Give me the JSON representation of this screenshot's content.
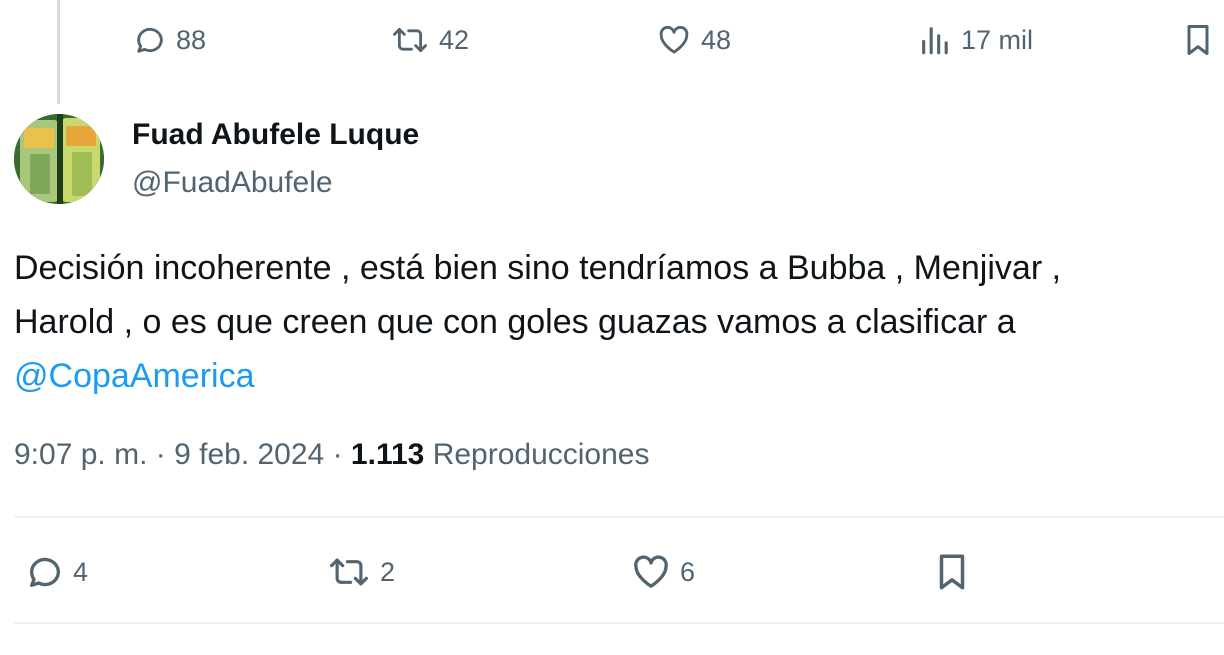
{
  "previous_tweet": {
    "actions": {
      "reply_count": "88",
      "retweet_count": "42",
      "like_count": "48",
      "views_count": "17 mil"
    }
  },
  "tweet": {
    "author": {
      "name": "Fuad Abufele Luque",
      "handle": "@FuadAbufele"
    },
    "text_lines": [
      "Decisión incoherente , está bien sino tendríamos a Bubba , Menjivar ,",
      "Harold , o es que creen que con goles guazas vamos a clasificar a"
    ],
    "mention": "@CopaAmerica",
    "meta": {
      "time": "9:07 p. m.",
      "separator": "·",
      "date": "9 feb. 2024",
      "views": "1.113",
      "views_label": "Reproducciones"
    },
    "actions": {
      "reply_count": "4",
      "retweet_count": "2",
      "like_count": "6"
    }
  },
  "colors": {
    "text_primary": "#0f1419",
    "text_secondary": "#536471",
    "link": "#1d9bf0",
    "divider": "#eff3f4",
    "thread_line": "#cfd9de"
  },
  "icons": [
    "reply-icon",
    "retweet-icon",
    "like-icon",
    "views-icon",
    "bookmark-icon"
  ]
}
